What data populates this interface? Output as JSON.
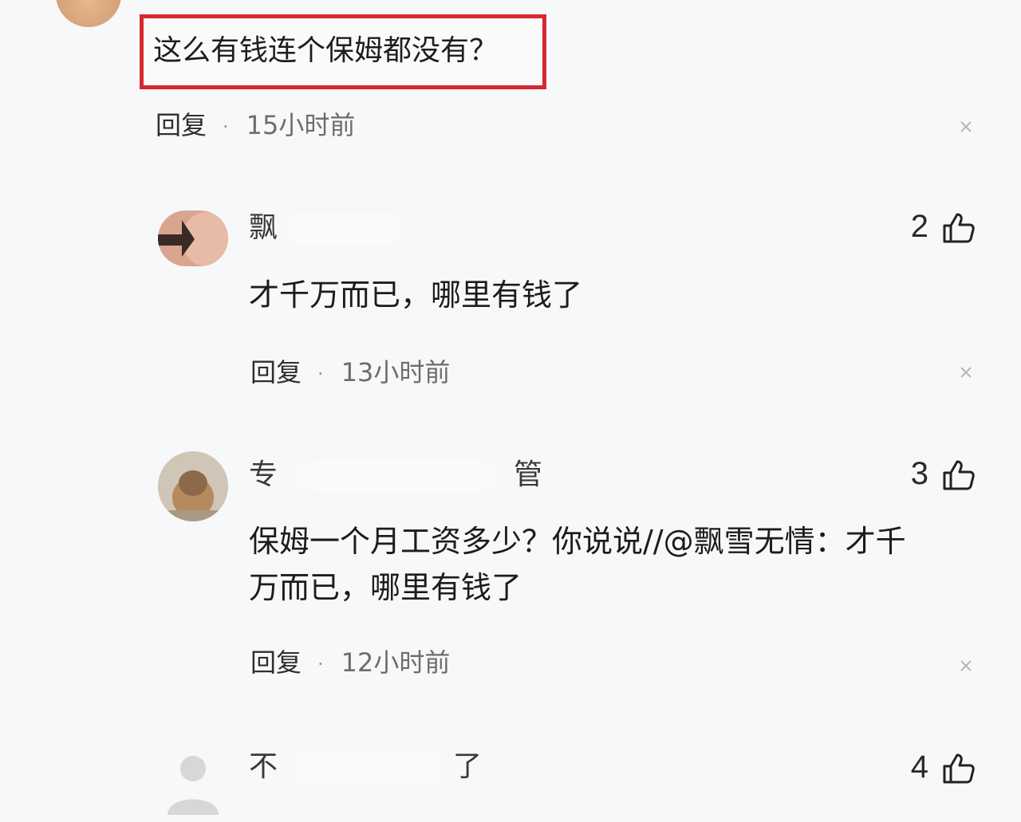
{
  "top_comment": {
    "text": "这么有钱连个保姆都没有？",
    "reply_label": "回复",
    "time": "15小时前"
  },
  "replies": [
    {
      "username_prefix": "飘",
      "username_suffix": "",
      "likes": "2",
      "text_lines": [
        "才千万而已，哪里有钱了"
      ],
      "reply_label": "回复",
      "time": "13小时前"
    },
    {
      "username_prefix": "专",
      "username_suffix": "管",
      "likes": "3",
      "text_lines": [
        "保姆一个月工资多少？你说说//@飘雪无情：才千",
        "万而已，哪里有钱了"
      ],
      "reply_label": "回复",
      "time": "12小时前"
    },
    {
      "username_prefix": "不",
      "username_suffix": "了",
      "likes": "4",
      "text_lines": [],
      "reply_label": "",
      "time": ""
    }
  ],
  "colors": {
    "highlight_border": "#d6282f",
    "background": "#f7f8fa"
  }
}
